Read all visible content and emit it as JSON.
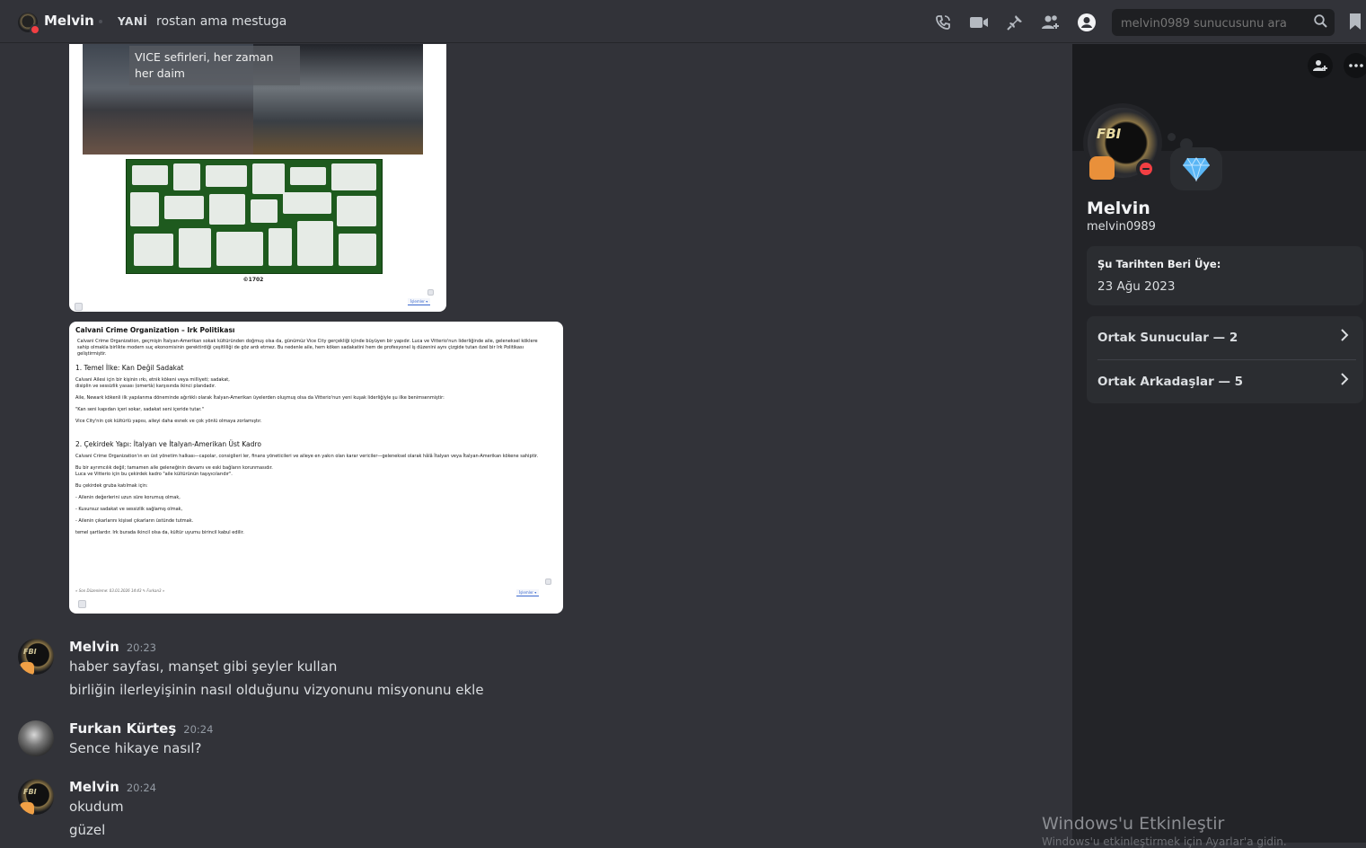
{
  "header": {
    "name": "Melvin",
    "tag": "YANİ",
    "status": "rostan ama mestuga",
    "search_placeholder": "melvin0989 sunucusunu ara",
    "icons": [
      "phone-call-icon",
      "video-call-icon",
      "pin-icon",
      "add-friend-icon",
      "user-profile-icon",
      "search-icon",
      "bookmark-icon"
    ]
  },
  "attachment1": {
    "caption": "VICE sefirleri, her zaman her daim",
    "copyright": "©1702",
    "button": "İşlemler ▾"
  },
  "attachment2": {
    "title": "Calvani Crime Organization – Irk Politikası",
    "intro": "Calvani Crime Organization, geçmişin İtalyan-Amerikan sokak kültüründen doğmuş olsa da, günümüz Vice City gerçekliği içinde büyüyen bir yapıdır. Luca ve Vitterio'nun liderliğinde aile, geleneksel köklere sahip olmakla birlikte modern suç ekonomisinin gerektirdiği çeşitliliği de göz ardı etmez. Bu nedenle aile, hem köken sadakatini hem de profesyonel iş düzenini aynı çizgide tutan özel bir Irk Politikası geliştirmiştir.",
    "h1": "1. Temel İlke: Kan Değil Sadakat",
    "p1": "Calvani Ailesi için bir kişinin ırkı, etnik kökeni veya milliyeti; sadakat, disiplin ve sessizlik yasası (omertà) karşısında ikinci plandadır.",
    "p2": "Aile, Newark kökenli ilk yapılanma döneminde ağırlıklı olarak İtalyan-Amerikan üyelerden oluşmuş olsa da Vitterio'nun yeni kuşak liderliğiyle şu ilke benimsenmiştir:",
    "p3": "\"Kan seni kapıdan içeri sokar, sadakat seni içeride tutar.\"",
    "p4": "Vice City'nin çok kültürlü yapısı, aileyi daha esnek ve çok yönlü olmaya zorlamıştır.",
    "h2": "2. Çekirdek Yapı: İtalyan ve İtalyan-Amerikan Üst Kadro",
    "p5": "Calvani Crime Organization'ın en üst yönetim halkası—capolar, consiglieri ler, finans yöneticileri ve aileye en yakın olan karar vericiler—geleneksel olarak hâlâ İtalyan veya İtalyan-Amerikan kökene sahiptir.",
    "p6": "Bu bir ayrımcılık değil; tamamen aile geleneğinin devamı ve eski bağların korunmasıdır. Luca ve Vitterio için bu çekirdek kadro \"aile kültürünün taşıyıcılarıdır\".",
    "p7": "Bu çekirdek gruba katılmak için:",
    "p8": "- Ailenin değerlerini uzun süre korumuş olmak,",
    "p9": "- Kusursuz sadakat ve sessizlik sağlamış olmak,",
    "p10": "- Ailenin çıkarlarını kişisel çıkarların üstünde tutmak.",
    "p11": "temel şartlardır. Irk burada ikincil olsa da, kültür uyumu birincil kabul edilir.",
    "footer": "« Son Düzenleme: 03.01.2026 14:43 ✎ Furkan3 »",
    "button": "İşlemler ▾"
  },
  "messages": [
    {
      "author": "Melvin",
      "time": "20:23",
      "lines": [
        "haber sayfası, manşet gibi şeyler kullan",
        "birliğin ilerleyişinin nasıl olduğunu vizyonunu misyonunu ekle"
      ]
    },
    {
      "author": "Furkan Kürteş",
      "time": "20:24",
      "lines": [
        "Sence hikaye nasıl?"
      ]
    },
    {
      "author": "Melvin",
      "time": "20:24",
      "lines": [
        "okudum",
        "güzel"
      ]
    }
  ],
  "profile": {
    "name": "Melvin",
    "username": "melvin0989",
    "member_since_label": "Şu Tarihten Beri Üye:",
    "member_since": "23 Ağu 2023",
    "mutual_servers": "Ortak Sunucular — 2",
    "mutual_friends": "Ortak Arkadaşlar — 5"
  },
  "watermark": {
    "title": "Windows'u Etkinleştir",
    "subtitle": "Windows'u etkinleştirmek için Ayarlar'a gidin."
  },
  "colors": {
    "background": "#323339",
    "panel": "#232428",
    "dnd": "#f23f43",
    "nitro_gem": "#5ab6f5"
  }
}
